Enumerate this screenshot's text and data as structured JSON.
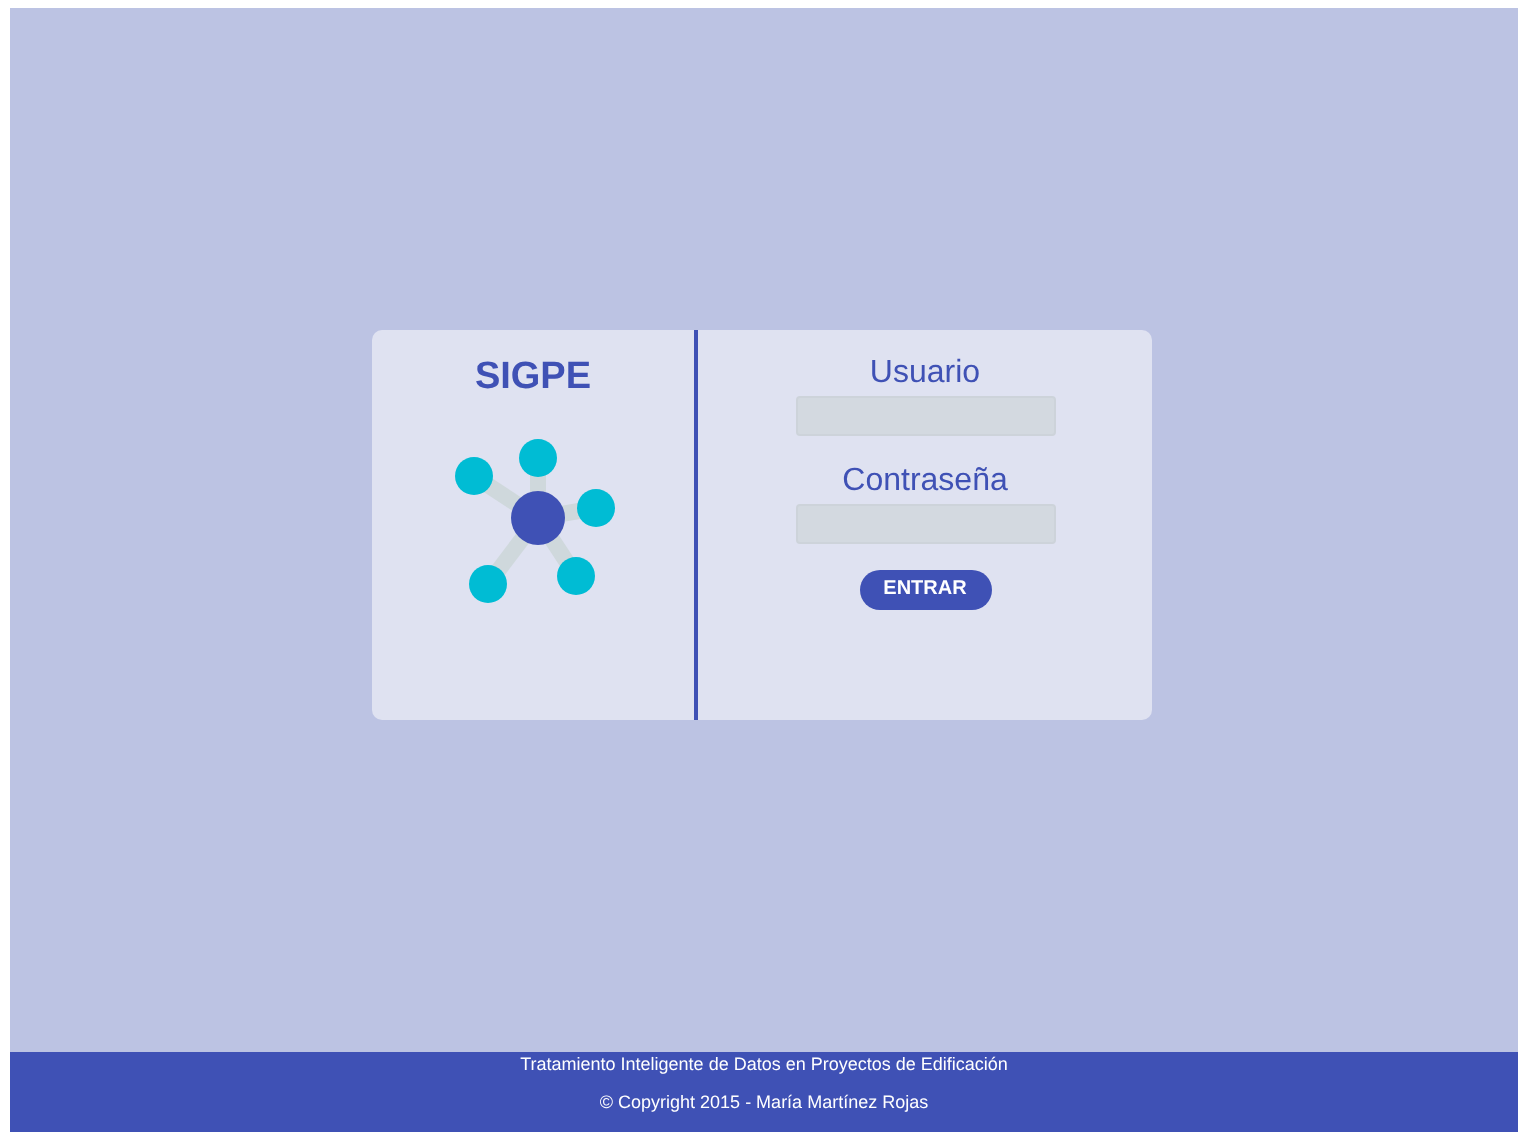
{
  "brand": {
    "title": "SIGPE"
  },
  "login": {
    "fields": [
      {
        "label": "Usuario"
      },
      {
        "label": "Contraseña"
      }
    ],
    "button": "ENTRAR"
  },
  "footer": {
    "lines": [
      "Tratamiento Inteligente de Datos en Proyectos de Edificación",
      "© Copyright 2015 - María Martínez Rojas"
    ]
  }
}
